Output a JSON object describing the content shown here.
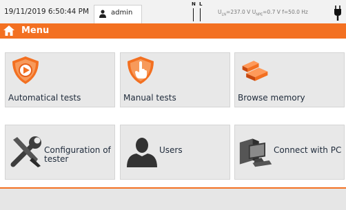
{
  "status_bar": {
    "datetime": "19/11/2019 6:50:44 PM",
    "user": "admin",
    "phase_n": "N",
    "phase_l": "L",
    "u_ln_label": "U",
    "u_ln_sub": "LN",
    "u_ln_value": "=237.0 V",
    "u_npe_label": "U",
    "u_npe_sub": "NPE",
    "u_npe_value": "=0.7 V",
    "freq": "f=50.0 Hz"
  },
  "header": {
    "title": "Menu"
  },
  "tiles": [
    {
      "label": "Automatical tests",
      "icon": "shield-play-icon"
    },
    {
      "label": "Manual tests",
      "icon": "shield-hand-icon"
    },
    {
      "label": "Browse memory",
      "icon": "memory-blocks-icon"
    },
    {
      "label": "Configuration of tester",
      "icon": "tools-icon"
    },
    {
      "label": "Users",
      "icon": "user-silhouette-icon"
    },
    {
      "label": "Connect with PC",
      "icon": "computer-icon"
    }
  ],
  "colors": {
    "accent": "#f37021",
    "tile_bg": "#e8e8e8",
    "status_bg": "#f2f2f2"
  }
}
